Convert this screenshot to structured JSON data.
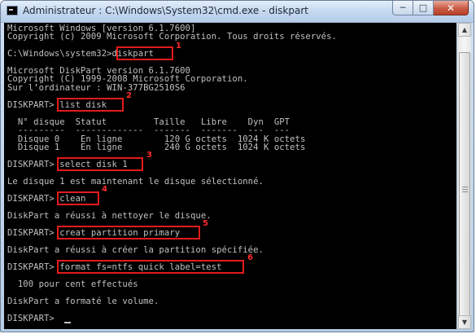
{
  "window": {
    "title": "Administrateur : C:\\Windows\\System32\\cmd.exe - diskpart",
    "min_glyph": "─",
    "max_glyph": "□",
    "close_glyph": "✕"
  },
  "console": {
    "lines": [
      "Microsoft Windows [version 6.1.7600]",
      "Copyright (c) 2009 Microsoft Corporation. Tous droits réservés.",
      "",
      "C:\\Windows\\system32>diskpart",
      "",
      "Microsoft DiskPart version 6.1.7600",
      "Copyright (C) 1999-2008 Microsoft Corporation.",
      "Sur l’ordinateur : WIN-377BG2510S6",
      "",
      "DISKPART> list disk",
      "",
      "  N° disque  Statut         Taille   Libre    Dyn  GPT",
      "  ---------  -------------  -------  -------  ---  ---",
      "  Disque 0    En ligne        120 G octets  1024 K octets",
      "  Disque 1    En ligne        240 G octets  1024 K octets",
      "",
      "DISKPART> select disk 1",
      "",
      "Le disque 1 est maintenant le disque sélectionné.",
      "",
      "DISKPART> clean",
      "",
      "DiskPart a réussi à nettoyer le disque.",
      "",
      "DISKPART> creat partition primary",
      "",
      "DiskPart a réussi à créer la partition spécifiée.",
      "",
      "DISKPART> format fs=ntfs quick label=test",
      "",
      "  100 pour cent effectués",
      "",
      "DiskPart a formaté le volume.",
      "",
      "DISKPART> "
    ]
  },
  "annotations": {
    "steps": [
      "1",
      "2",
      "3",
      "4",
      "5",
      "6"
    ]
  },
  "colors": {
    "console_bg": "#000000",
    "console_text": "#c0c0c0",
    "highlight": "#e21b1b"
  }
}
